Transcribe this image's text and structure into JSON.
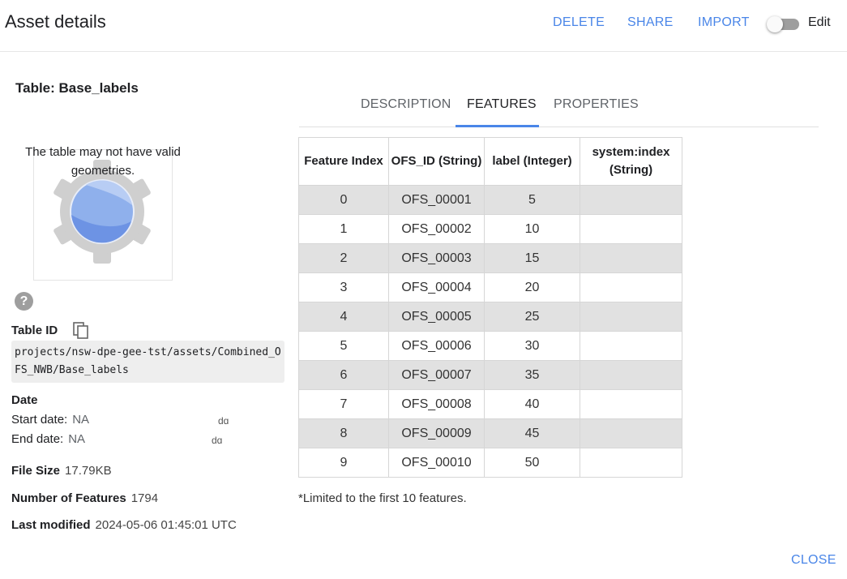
{
  "header": {
    "title": "Asset details",
    "buttons": {
      "delete": "DELETE",
      "share": "SHARE",
      "import": "IMPORT"
    },
    "edit_label": "Edit",
    "edit_toggle_on": false
  },
  "left": {
    "table_title": "Table: Base_labels",
    "thumbnail_message": "The table may not have valid geometries.",
    "help_icon": "help-circle-icon",
    "table_id_label": "Table ID",
    "copy_icon": "copy-icon",
    "table_id_value": "projects/nsw-dpe-gee-tst/assets/Combined_OFS_NWB/Base_labels",
    "date_heading": "Date",
    "start_date_label": "Start date:",
    "start_date_value": "NA",
    "end_date_label": "End date:",
    "end_date_value": "NA",
    "clipped_start": "dɑ",
    "clipped_end": "dɑ",
    "file_size_label": "File Size",
    "file_size_value": "17.79KB",
    "num_features_label": "Number of Features",
    "num_features_value": "1794",
    "last_modified_label": "Last modified",
    "last_modified_value": "2024-05-06 01:45:01 UTC"
  },
  "tabs": [
    {
      "label": "DESCRIPTION",
      "active": false
    },
    {
      "label": "FEATURES",
      "active": true
    },
    {
      "label": "PROPERTIES",
      "active": false
    }
  ],
  "features_table": {
    "headers": [
      "Feature Index",
      "OFS_ID (String)",
      "label (Integer)",
      "system:index (String)"
    ],
    "rows": [
      [
        "0",
        "OFS_00001",
        "5",
        ""
      ],
      [
        "1",
        "OFS_00002",
        "10",
        ""
      ],
      [
        "2",
        "OFS_00003",
        "15",
        ""
      ],
      [
        "3",
        "OFS_00004",
        "20",
        ""
      ],
      [
        "4",
        "OFS_00005",
        "25",
        ""
      ],
      [
        "5",
        "OFS_00006",
        "30",
        ""
      ],
      [
        "6",
        "OFS_00007",
        "35",
        ""
      ],
      [
        "7",
        "OFS_00008",
        "40",
        ""
      ],
      [
        "8",
        "OFS_00009",
        "45",
        ""
      ],
      [
        "9",
        "OFS_00010",
        "50",
        ""
      ]
    ],
    "note": "*Limited to the first 10 features."
  },
  "footer": {
    "close": "CLOSE"
  },
  "colors": {
    "accent": "#4a86e8",
    "row_stripe": "#e1e1e1"
  }
}
